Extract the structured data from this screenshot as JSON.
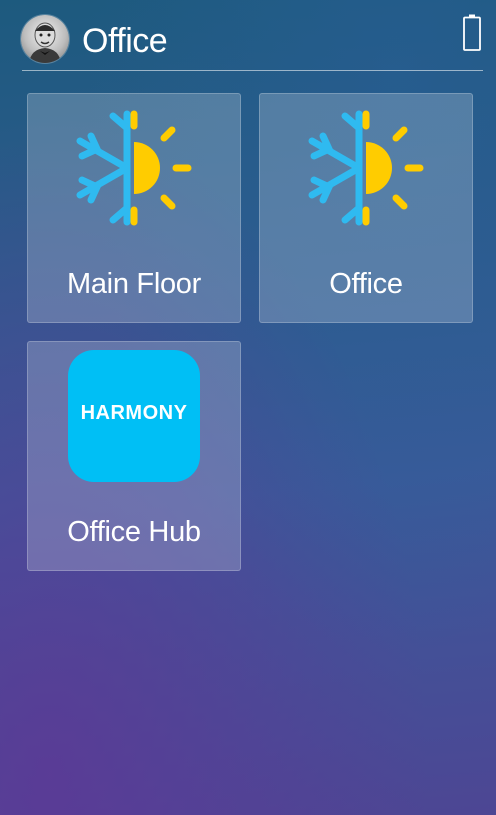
{
  "header": {
    "title": "Office",
    "avatar_icon": "user-avatar",
    "battery_icon": "battery-icon"
  },
  "tiles": [
    {
      "label": "Main Floor",
      "icon": "climate-icon"
    },
    {
      "label": "Office",
      "icon": "climate-icon"
    },
    {
      "label": "Office Hub",
      "icon": "harmony-app-icon",
      "icon_text": "HARMONY"
    }
  ],
  "colors": {
    "snowflake": "#2fbaf0",
    "sun": "#ffcc00",
    "harmony": "#00bff5"
  }
}
